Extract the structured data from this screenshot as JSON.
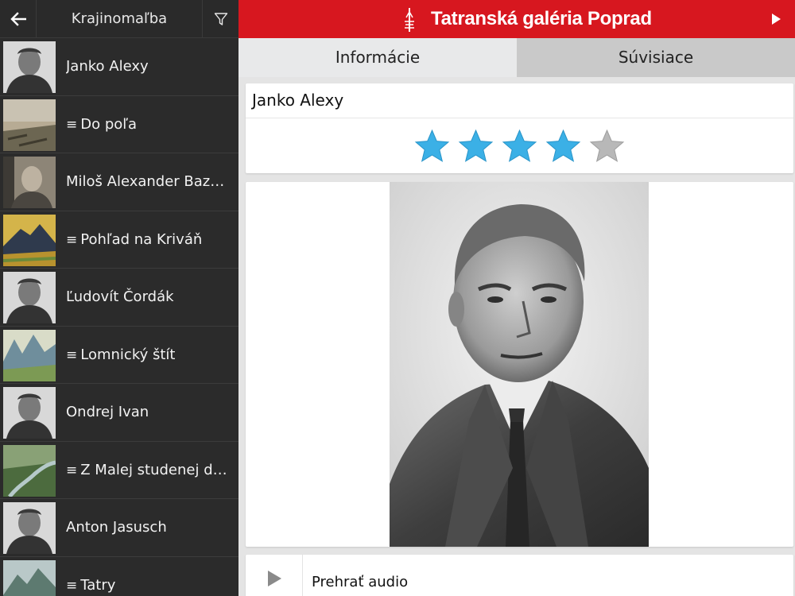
{
  "app": {
    "title": "Tatranská galéria Poprad",
    "brand_color": "#d7171f"
  },
  "sidebar": {
    "title": "Krajinomaľba",
    "back_icon": "arrow-left-icon",
    "filter_icon": "filter-icon",
    "items": [
      {
        "label": "Janko Alexy",
        "kind": "artist",
        "thumb": "portrait-bw"
      },
      {
        "label": "Do poľa",
        "kind": "artwork",
        "thumb": "painting-field"
      },
      {
        "label": "Miloš Alexander Bazovský",
        "kind": "artist",
        "thumb": "portrait-sepia"
      },
      {
        "label": "Pohľad na Kriváň",
        "kind": "artwork",
        "thumb": "painting-mountain"
      },
      {
        "label": "Ľudovít Čordák",
        "kind": "artist",
        "thumb": "portrait-bw"
      },
      {
        "label": "Lomnický štít",
        "kind": "artwork",
        "thumb": "painting-peaks"
      },
      {
        "label": "Ondrej Ivan",
        "kind": "artist",
        "thumb": "portrait-bw"
      },
      {
        "label": "Z Malej studenej doliny",
        "kind": "artwork",
        "thumb": "painting-stream"
      },
      {
        "label": "Anton Jasusch",
        "kind": "artist",
        "thumb": "portrait-bw"
      },
      {
        "label": "Tatry",
        "kind": "artwork",
        "thumb": "painting-tatry"
      }
    ],
    "list_marker": "≡"
  },
  "tabs": [
    {
      "label": "Informácie",
      "active": true
    },
    {
      "label": "Súvisiace",
      "active": false
    }
  ],
  "detail": {
    "name": "Janko Alexy",
    "rating": 4,
    "rating_max": 5,
    "star_on_color": "#3bb0e6",
    "star_off_color": "#b8b8b8",
    "audio_label": "Prehrať audio"
  }
}
